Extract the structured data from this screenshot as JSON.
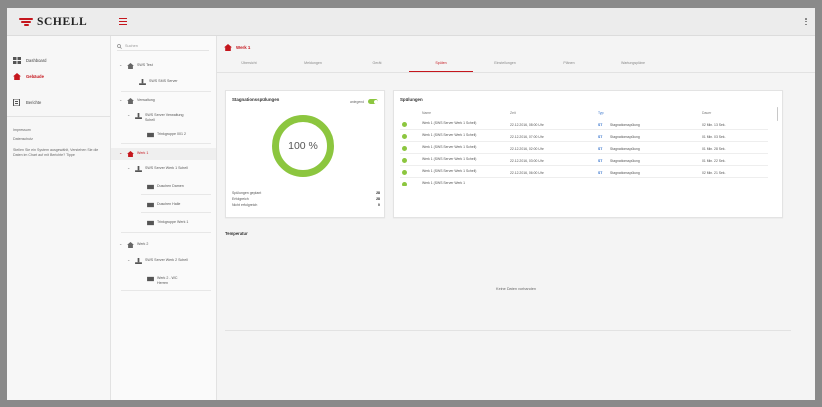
{
  "app": {
    "brand": "SCHELL",
    "brand_color": "#c5161d",
    "accent_green": "#8cc63f",
    "link_blue": "#2a6bc9"
  },
  "sidebar": {
    "items": [
      {
        "label": "Dashboard",
        "icon": "grid-icon",
        "active": false
      },
      {
        "label": "Gebäude",
        "icon": "home-icon",
        "active": true
      },
      {
        "label": "Berichte",
        "icon": "report-icon",
        "active": false
      }
    ],
    "links": [
      "Impressum",
      "Datenschutz"
    ],
    "note": "Stellen Sie ein System ausgewählt, Verstehen Sie die Daten im Chart auf mit Berichte? Tippe"
  },
  "tree": {
    "search_placeholder": "Suchen",
    "nodes": [
      {
        "label": "SWS Test",
        "kind": "building",
        "level": 0
      },
      {
        "label": "SWS SMS Server",
        "kind": "server",
        "level": 1
      },
      {
        "label": "Verwaltung",
        "kind": "building",
        "level": 0
      },
      {
        "label": "SWS Server Verwaltung Schell",
        "kind": "server",
        "level": 1
      },
      {
        "label": "Trinkgruppe 001 2",
        "kind": "group",
        "level": 2
      },
      {
        "label": "Werk 1",
        "kind": "building",
        "level": 0,
        "selected": true
      },
      {
        "label": "SWS Server Werk 1 Schell",
        "kind": "server",
        "level": 1
      },
      {
        "label": "Duschen Damen",
        "kind": "group",
        "level": 2
      },
      {
        "label": "Duschen Halle",
        "kind": "group",
        "level": 2
      },
      {
        "label": "Trinkgruppe Werk 1",
        "kind": "group",
        "level": 2
      },
      {
        "label": "Werk 2",
        "kind": "building",
        "level": 0
      },
      {
        "label": "SWS Server Werk 2 Schell",
        "kind": "server",
        "level": 1
      },
      {
        "label": "Werk 2 - WC Herren",
        "kind": "group",
        "level": 2
      }
    ]
  },
  "main": {
    "breadcrumb": "Werk 1",
    "tabs": [
      {
        "label": "Übersicht",
        "active": false
      },
      {
        "label": "Meldungen",
        "active": false
      },
      {
        "label": "Gerät",
        "active": false
      },
      {
        "label": "Spülen",
        "active": true
      },
      {
        "label": "Einstellungen",
        "active": false
      },
      {
        "label": "Plänen",
        "active": false
      },
      {
        "label": "Wartungspläne",
        "active": false
      }
    ],
    "stagnation": {
      "title": "Stagnationsspülungen",
      "toggle_label": "anlegend",
      "percent_text": "100 %",
      "percent_value": 100,
      "stats": [
        {
          "label": "Spülungen geplant",
          "value": "28"
        },
        {
          "label": "Erfolgreich",
          "value": "28"
        },
        {
          "label": "Nicht erfolgreich",
          "value": "0"
        }
      ]
    },
    "flushes": {
      "title": "Spülungen",
      "columns": [
        "Name",
        "Zeit",
        "Typ",
        "",
        "Dauer"
      ],
      "rows": [
        {
          "name": "Werk 1 (SWS Server Werk 1 Schell)",
          "time": "22.12.2016, 08:00 Uhr",
          "code": "ST",
          "type": "Stagnationsspülung",
          "duration": "02 Min. 13 Sek."
        },
        {
          "name": "Werk 1 (SWS Server Werk 1 Schell)",
          "time": "22.12.2016, 07:00 Uhr",
          "code": "ST",
          "type": "Stagnationsspülung",
          "duration": "01 Min. 03 Sek."
        },
        {
          "name": "Werk 1 (SWS Server Werk 1 Schell)",
          "time": "22.12.2016, 02:00 Uhr",
          "code": "ST",
          "type": "Stagnationsspülung",
          "duration": "01 Min. 28 Sek."
        },
        {
          "name": "Werk 1 (SWS Server Werk 1 Schell)",
          "time": "22.12.2016, 03:00 Uhr",
          "code": "ST",
          "type": "Stagnationsspülung",
          "duration": "01 Min. 22 Sek."
        },
        {
          "name": "Werk 1 (SWS Server Werk 1 Schell)",
          "time": "22.12.2016, 06:00 Uhr",
          "code": "ST",
          "type": "Stagnationsspülung",
          "duration": "02 Min. 21 Sek."
        },
        {
          "name": "Werk 1 (SWS Server Werk 1",
          "time": "",
          "code": "",
          "type": "",
          "duration": ""
        }
      ]
    },
    "temperature": {
      "title": "Temperatur",
      "empty_text": "Keine Daten vorhanden"
    }
  }
}
